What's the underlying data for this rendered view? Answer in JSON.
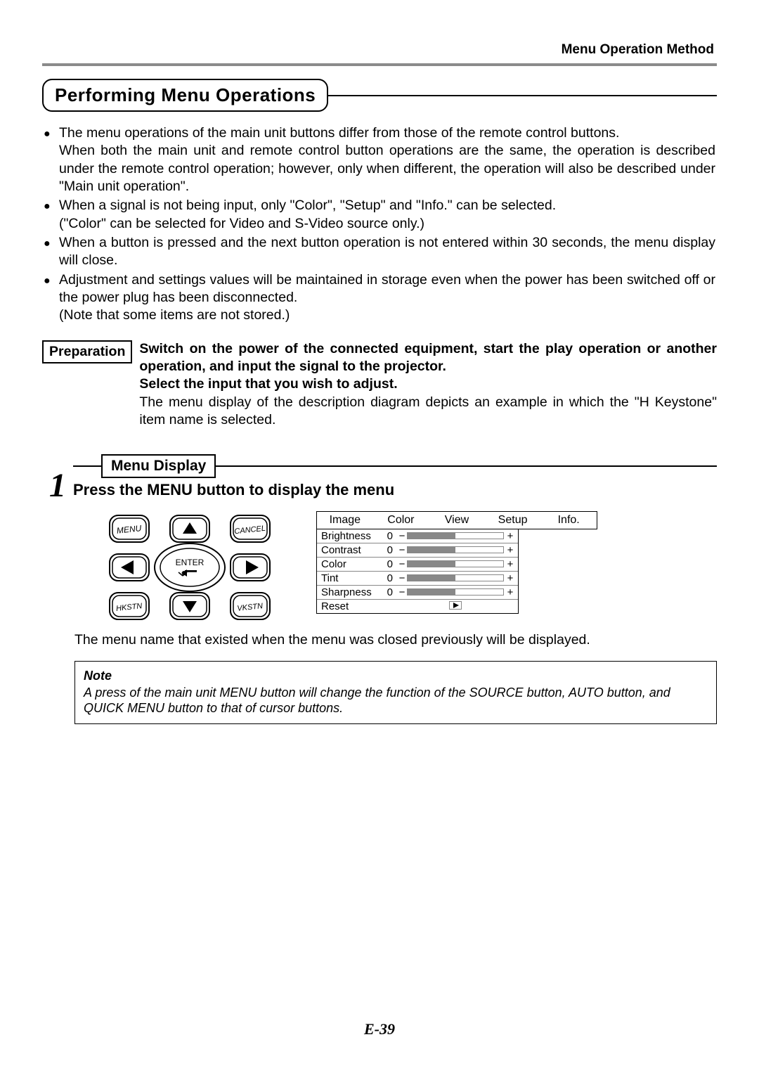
{
  "header_right": "Menu Operation Method",
  "section_title": "Performing Menu Operations",
  "bullets": [
    {
      "main": "The menu operations of the main unit buttons differ from those of the remote control buttons.",
      "cont": "When both the main unit and remote control button operations are the same, the operation is described under the remote control operation; however, only when different, the operation will also be described under \"Main unit operation\"."
    },
    {
      "main": "When a signal is not being input, only \"Color\", \"Setup\" and \"Info.\" can be selected.",
      "cont": " (\"Color\" can be selected for Video and S-Video source only.)"
    },
    {
      "main": "When a button is pressed and the next button operation is not entered within 30 seconds, the menu display will close.",
      "cont": ""
    },
    {
      "main": "Adjustment and settings values will be maintained in storage even when the power has been switched off or the power plug has been disconnected.",
      "cont": "(Note that some items are not stored.)"
    }
  ],
  "preparation": {
    "label": "Preparation",
    "bold": "Switch on the power of the connected equipment, start the play operation or another operation, and input the signal to the projector.\nSelect the input that you wish to adjust.",
    "rest": "The menu display of the description diagram depicts an example in which the \"H Keystone\" item name is selected."
  },
  "step": {
    "num": "1",
    "title": "Menu Display",
    "subtitle": "Press the MENU button to display the menu"
  },
  "remote_buttons": {
    "menu": "MENU",
    "cancel": "CANCEL",
    "enter": "ENTER",
    "hkstn": "HKSTN",
    "vkstn": "VKSTN"
  },
  "menu_tabs": [
    "Image",
    "Color",
    "View",
    "Setup",
    "Info."
  ],
  "menu_rows": [
    {
      "name": "Brightness",
      "value": "0"
    },
    {
      "name": "Contrast",
      "value": "0"
    },
    {
      "name": "Color",
      "value": "0"
    },
    {
      "name": "Tint",
      "value": "0"
    },
    {
      "name": "Sharpness",
      "value": "0"
    }
  ],
  "menu_reset": "Reset",
  "after_text": "The menu name that existed when the menu was closed previously will be displayed.",
  "note": {
    "title": "Note",
    "body": "A press of the main unit MENU button will change the function of the SOURCE button, AUTO button, and QUICK MENU button to that of cursor buttons."
  },
  "page_number": "E-39"
}
